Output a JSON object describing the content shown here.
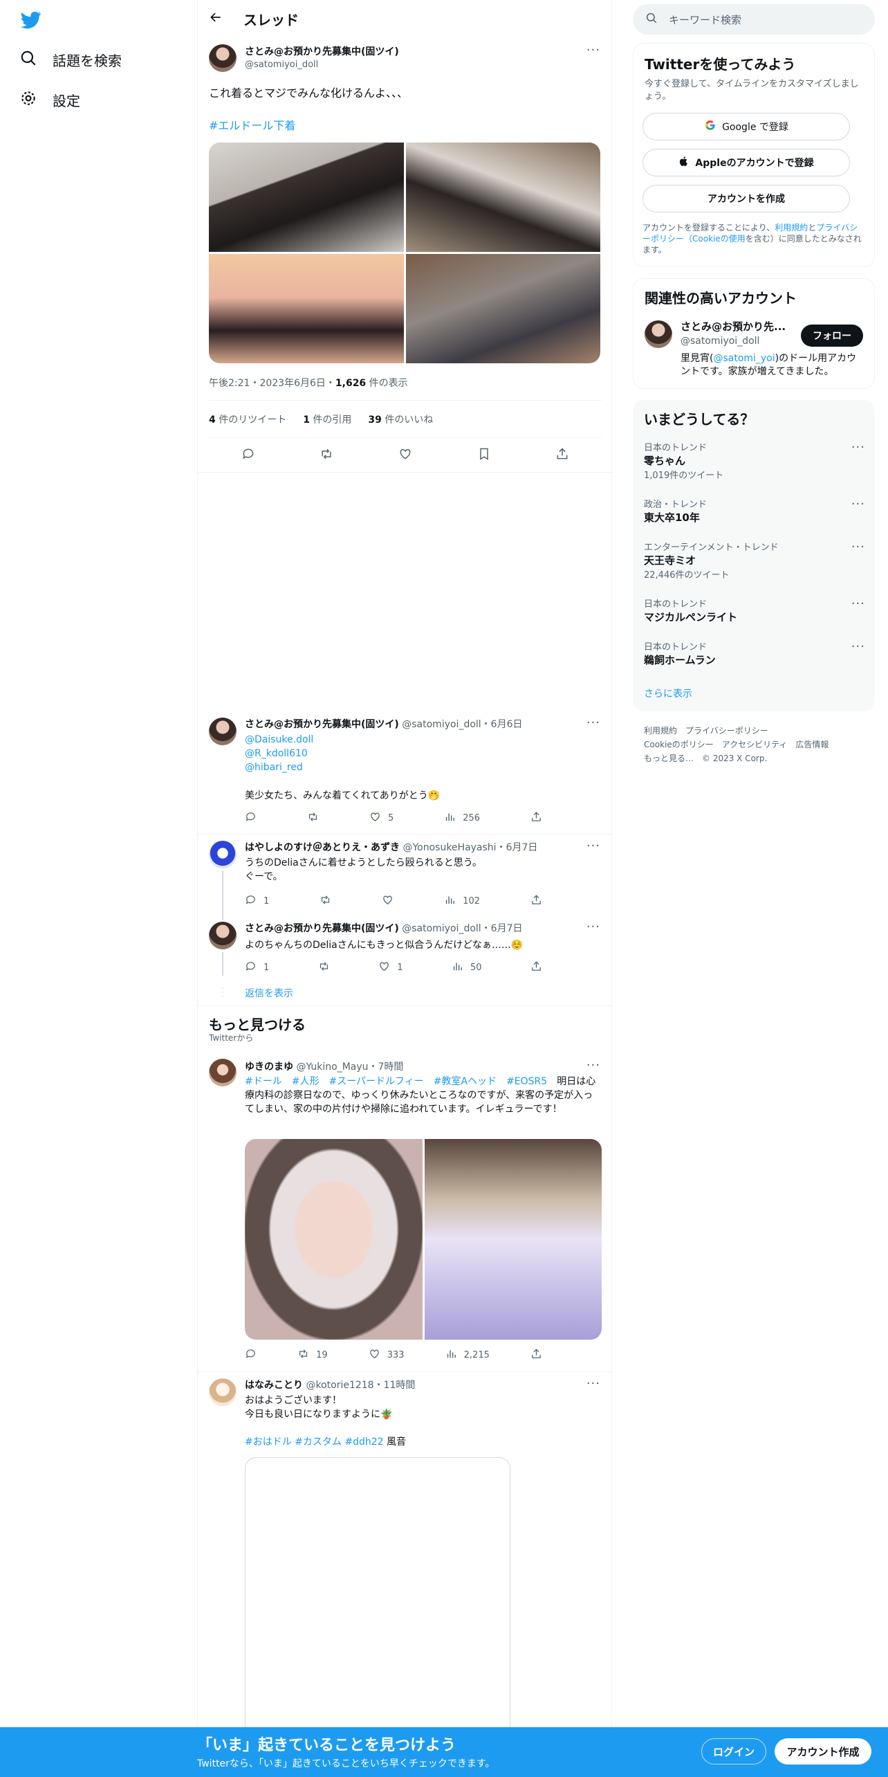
{
  "nav": {
    "explore": "話題を検索",
    "settings": "設定"
  },
  "header": {
    "title": "スレッド"
  },
  "main_tweet": {
    "name": "さとみ@お預かり先募集中(固ツイ)",
    "handle": "@satomiyoi_doll",
    "text": "これ着るとマジでみんな化けるんよ、、、",
    "hashtag": "#エルドール下着",
    "time": "午後2:21・2023年6月6日・",
    "views_num": "1,626",
    "views_label": " 件の表示",
    "retweets_num": "4",
    "retweets_label": " 件のリツイート",
    "quotes_num": "1",
    "quotes_label": " 件の引用",
    "likes_num": "39",
    "likes_label": " 件のいいね"
  },
  "reply1": {
    "name": "さとみ@お預かり先募集中(固ツイ)",
    "handle": "@satomiyoi_doll・6月6日",
    "mention1": "@Daisuke.doll",
    "mention2": "@R_kdoll610",
    "mention3": "@hibari_red",
    "text": "美少女たち、みんな着てくれてありがとう🤭",
    "likes": "5",
    "views": "256"
  },
  "reply2": {
    "name": "はやしよのすけ＠あとりえ・あずき",
    "handle": "@YonosukeHayashi・6月7日",
    "text1": "うちのDeliaさんに着せようとしたら殴られると思う。",
    "text2": "ぐーで。",
    "replies": "1",
    "views": "102"
  },
  "reply3": {
    "name": "さとみ@お預かり先募集中(固ツイ)",
    "handle": "@satomiyoi_doll・6月7日",
    "text": "よのちゃんちのDeliaさんにもきっと似合うんだけどなぁ……☺️",
    "replies": "1",
    "likes": "1",
    "views": "50"
  },
  "show_replies": "返信を表示",
  "discover": {
    "title": "もっと見つける",
    "subtitle": "Twitterから"
  },
  "tweet_d1": {
    "name": "ゆきのまゆ",
    "handle": "@Yukino_Mayu・7時間",
    "tags": "#ドール　#人形　#スーパードルフィー　#教室Aヘッド　#EOSR5",
    "text_inline": "　明日",
    "text": "は心療内科の診察日なので、ゆっくり休みたいところなのですが、来客の予定が入ってしまい、家の中の片付けや掃除に追われています。イレギュラーです！",
    "retweets": "19",
    "likes": "333",
    "views": "2,215"
  },
  "tweet_d2": {
    "name": "はなみことり",
    "handle": "@kotorie1218・11時間",
    "text1": "おはようございます！",
    "text2": "今日も良い日になりますように🪴",
    "tags": "#おはドル #カスタム #ddh22",
    "tail": " 風音"
  },
  "right": {
    "search_placeholder": "キーワード検索",
    "signup_title": "Twitterを使ってみよう",
    "signup_sub": "今すぐ登録して、タイムラインをカスタマイズしましょう。",
    "google_btn": "Google で登録",
    "apple_btn": "Appleのアカウントで登録",
    "create_btn": "アカウントを作成",
    "legal_pre": "アカウントを登録することにより、",
    "legal_terms": "利用規約",
    "legal_and": "と",
    "legal_privacy": "プライバシーポリシー（Cookieの使用",
    "legal_post": "を含む）に同意したとみなされます。",
    "related_title": "関連性の高いアカウント",
    "related_name": "さとみ@お預かり先...",
    "related_handle": "@satomiyoi_doll",
    "follow_btn": "フォロー",
    "related_bio_pre": "里見宵(",
    "related_bio_link": "@satomi_yoi",
    "related_bio_post": ")のドール用アカウントです。家族が増えてきました。",
    "trends_title": "いまどうしてる？",
    "trends": [
      {
        "cat": "日本のトレンド",
        "title": "零ちゃん",
        "count": "1,019件のツイート"
      },
      {
        "cat": "政治・トレンド",
        "title": "東大卒10年",
        "count": ""
      },
      {
        "cat": "エンターテインメント・トレンド",
        "title": "天王寺ミオ",
        "count": "22,446件のツイート"
      },
      {
        "cat": "日本のトレンド",
        "title": "マジカルペンライト",
        "count": ""
      },
      {
        "cat": "日本のトレンド",
        "title": "鵜飼ホームラン",
        "count": ""
      }
    ],
    "show_more": "さらに表示",
    "footer_line1": "利用規約　プライバシーポリシー",
    "footer_line2": "Cookieのポリシー　アクセシビリティ　広告情報",
    "footer_line3": "もっと見る…　© 2023 X Corp."
  },
  "bottom": {
    "headline": "「いま」起きていることを見つけよう",
    "sub": "Twitterなら、「いま」起きていることをいち早くチェックできます。",
    "login": "ログイン",
    "signup": "アカウント作成"
  }
}
